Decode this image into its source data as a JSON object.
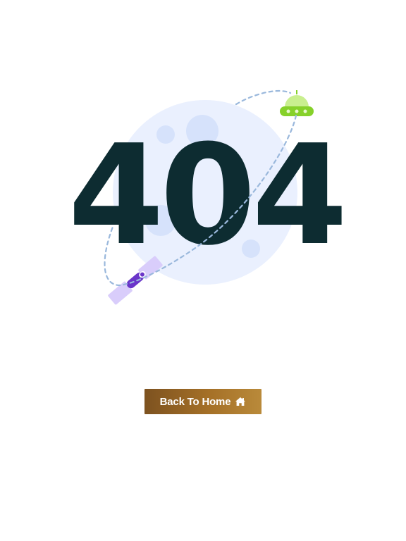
{
  "error": {
    "code": "404"
  },
  "actions": {
    "back_home_label": "Back To Home",
    "back_home_icon": "home-icon"
  },
  "colors": {
    "digits": "#0d2c31",
    "moon": "#eaf0fe",
    "craters": "#d6e2fb",
    "orbit": "#9ab8dc",
    "ufo_dome": "#c9ef8f",
    "ufo_body": "#86d12a",
    "satellite_panel": "#d9cdfb",
    "satellite_body": "#6a35c9",
    "button_start": "#7d5220",
    "button_end": "#b98a3a"
  }
}
